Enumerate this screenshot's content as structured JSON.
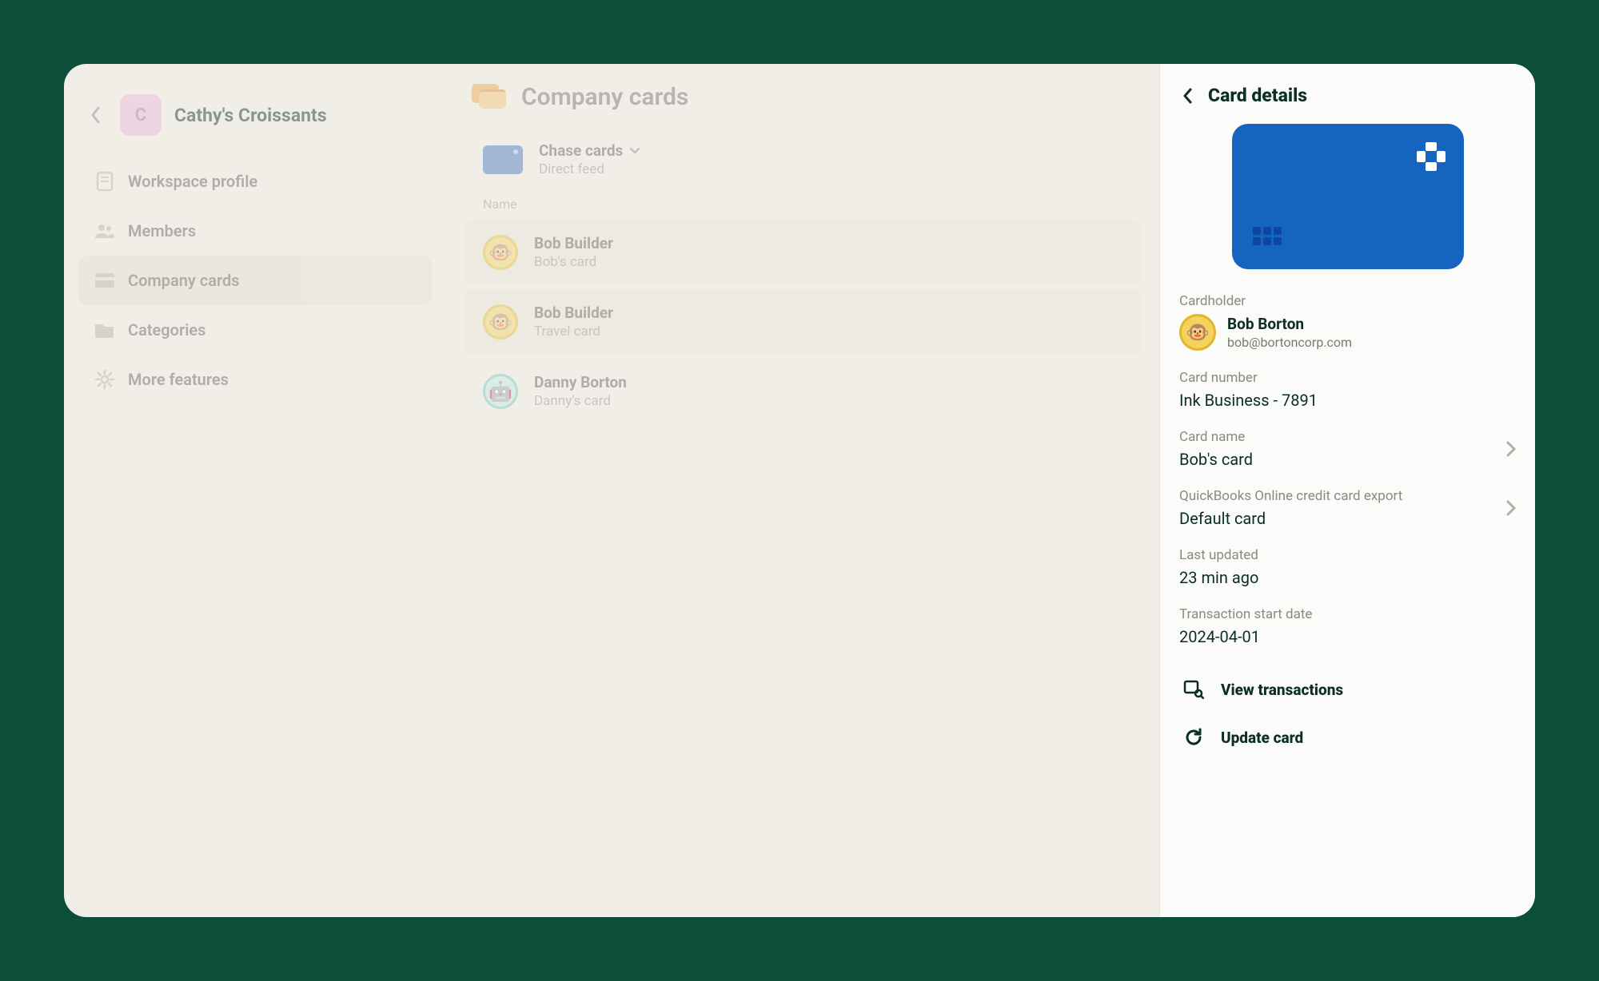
{
  "workspace": {
    "avatar_letter": "C",
    "name": "Cathy's Croissants"
  },
  "sidebar": {
    "items": [
      {
        "label": "Workspace profile"
      },
      {
        "label": "Members"
      },
      {
        "label": "Company cards"
      },
      {
        "label": "Categories"
      },
      {
        "label": "More features"
      }
    ]
  },
  "main": {
    "title": "Company cards",
    "feed": {
      "name": "Chase cards",
      "subtitle": "Direct feed"
    },
    "list_label": "Name",
    "cards": [
      {
        "name": "Bob Builder",
        "subtitle": "Bob's card",
        "avatar": "gold"
      },
      {
        "name": "Bob Builder",
        "subtitle": "Travel card",
        "avatar": "gold"
      },
      {
        "name": "Danny Borton",
        "subtitle": "Danny's card",
        "avatar": "teal"
      }
    ]
  },
  "panel": {
    "title": "Card details",
    "cardholder_label": "Cardholder",
    "cardholder": {
      "name": "Bob Borton",
      "email": "bob@bortoncorp.com"
    },
    "card_number_label": "Card number",
    "card_number_value": "Ink Business - 7891",
    "card_name_label": "Card name",
    "card_name_value": "Bob's card",
    "export_label": "QuickBooks Online credit card export",
    "export_value": "Default card",
    "last_updated_label": "Last updated",
    "last_updated_value": "23 min ago",
    "start_date_label": "Transaction start date",
    "start_date_value": "2024-04-01",
    "view_tx_label": "View transactions",
    "update_card_label": "Update card"
  },
  "colors": {
    "card_bg": "#1565c0",
    "panel_bg": "#fbfbf9",
    "app_bg": "#f0eee6",
    "page_bg": "#0b4f3a"
  }
}
